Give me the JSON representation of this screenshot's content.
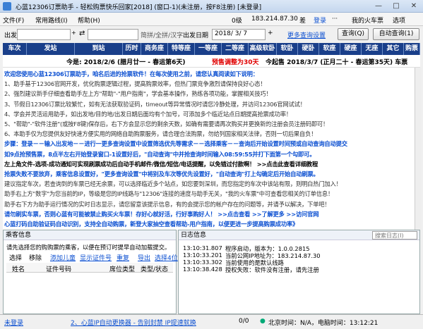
{
  "titlebar": {
    "title": "心蓝12306订票助手 - 轻松购票快乐回家[2018] (窗口-1)(未注册，按F8注册) [未登录]",
    "min": "—",
    "max": "□",
    "close": "✕"
  },
  "menu": {
    "items": [
      "文件(F)",
      "常用路线(I)",
      "帮助(H)"
    ],
    "level": "0级",
    "ip": "183.214.87.30",
    "net": "差",
    "login": "登录",
    "my_train": "我的火车票",
    "options": "选项"
  },
  "search": {
    "from_label": "出发",
    "swap": "⇄",
    "filter_hint": "简拼/全拼/汉字",
    "date_label": "出发日期",
    "date_value": "2018/ 3/ 7",
    "more_link": "更多查询设置",
    "query_btn": "查询(Q)",
    "auto_query_btn": "自动查询(1)"
  },
  "table": {
    "headers": [
      "车次",
      "发站",
      "到站",
      "历时",
      "商务座",
      "特等座",
      "一等座",
      "二等座",
      "高级软卧",
      "软卧",
      "硬卧",
      "软座",
      "硬座",
      "无座",
      "其它",
      "购票"
    ]
  },
  "dates": {
    "today": "今是: 2018/2/6 (腊月廿一 - 春运第6天)",
    "presale": "预售调整为30天",
    "target": "今起售 2018/3/7 (正月二十 - 春运第35天) 车票"
  },
  "notice": {
    "lines": [
      {
        "t": "欢迎您使用心蓝12306订票助手，咱名后进的抢票软件！在每次使用之前，请您认真阅读如下说明：",
        "c": "blue"
      },
      {
        "t": "1、助手基于12306官网开发，优化购票逻辑过程，提高购票效率，但热门票竞争激烈请保持良好心态！",
        "c": "gray"
      },
      {
        "t": "2、强烈建议新手仔细查看助手左上方\"帮助\"-\"用户指南\"，学会基本操作，熟练各项功能，掌握相关技巧！",
        "c": "gray"
      },
      {
        "t": "3、节假日12306订票比较繁忙，如有无法获取验证码，timeout等异常情况时请您冷静处理，并访问12306官网试试！",
        "c": "gray"
      },
      {
        "t": "4、学会并灵活运用助手，如出发地/目的地/出发日期后面均有个加号，可添加多个临近站点日期提高抢票成功率！",
        "c": "gray"
      },
      {
        "t": "5、\"帮助\"-\"软件注册\"(或按F8键)保存后，右下方会显示您的剩余天数，如确有需要请再次购买并更换新的注册会员注册码即可！",
        "c": "gray"
      },
      {
        "t": "6、本助手仅为您提供友好快速方便实用的网络自助购票服务，请合理合法购票，勿给列国家相关法律，否则一切后果自负！",
        "c": "gray"
      },
      {
        "t": "步骤：登录－－输入出发地－－进行一更多查询设置中设置筛选优先等需求－－选择乘客－－查询后开始设置时间预或自动查询自动提交",
        "c": "blue"
      },
      {
        "t": "如9点抢预售票，8点半左右开始登录窗口-1设置好后，\"自动查询\"中并抢查询时间输入08:59:55并打下面第一个勾即可。",
        "c": "blue"
      },
      {
        "t": "左上角文件-选项-成功通知可实现刷票成功后自动手机邮件/微信/短信/电话提醒，以免错过付款啊！ >>点击此查看详细教程",
        "c": "blk"
      },
      {
        "t": "抢票失败不要放弃，乘客信息设置好，\"更多查询设置\"中将别及车次等优先设置好，\"自动查询\"打上勾确定后开始自动刷票。",
        "c": "blue"
      },
      {
        "t": "建议指定车次，若查询到的车票已经无余票，可以选择临近多个站点，如您要到深圳，而您指定的车次中该站有限，则明白热门加入！",
        "c": "gray"
      },
      {
        "t": "助手右上方\"数字\"为您当前的IP，等级是您的IP线路与\"12306\"连接的速度与助手无关，\"我的火车票\"中可查看您相关的订单信息！",
        "c": "gray"
      },
      {
        "t": "助手右下方为助手运行情况的实时日志显示，请您留意该提示信息，有的会提示您的帐户存在的问题等，并请予以解决，下单吧！",
        "c": "gray"
      },
      {
        "t": "请勿刷实车票，否则心蓝有可能被禁止购买火车票！存好心就好活，行好事购好人！ >>点击查看  >>了解更多  >>访问官网",
        "c": "blue"
      },
      {
        "t": "心蓝打码自助验证码自动识别，支持全自动购票，新登大家抽空查看帮助-用户指南，以便更进一步提高购票成功率》",
        "c": "blue"
      }
    ]
  },
  "left_panel": {
    "title": "乘客信息",
    "hint": "请先选择您的购购票的乘客，以便在预订时提早自动加载提交。",
    "tools": [
      "选择",
      "移除",
      "添加儿童",
      "显示证件号",
      "重复",
      "导出",
      "选择4位"
    ],
    "columns": [
      "姓名",
      "证件号码",
      "席位类型",
      "类型/状态"
    ]
  },
  "right_panel": {
    "title": "日志信息",
    "search_placeholder": "搜索日志(I)",
    "logs": [
      {
        "time": "13:10:31.807",
        "msg": "程序启动，版本为：1.0.0.2815"
      },
      {
        "time": "13:10:33.201",
        "msg": "当前公网IP地址为：183.214.87.30"
      },
      {
        "time": "13:10:33.302",
        "msg": "当前使用的是默认线路"
      },
      {
        "time": "13:10:38.428",
        "msg": "授权失败：软件没有注册，请先注册"
      }
    ]
  },
  "status": {
    "login": "未登录",
    "news": "2、心蓝IP自动更换器 - 告别封禁 IP提速就换",
    "counter": "0/0",
    "time": "北京时间：N/A，电脑时间：13:12:21"
  }
}
